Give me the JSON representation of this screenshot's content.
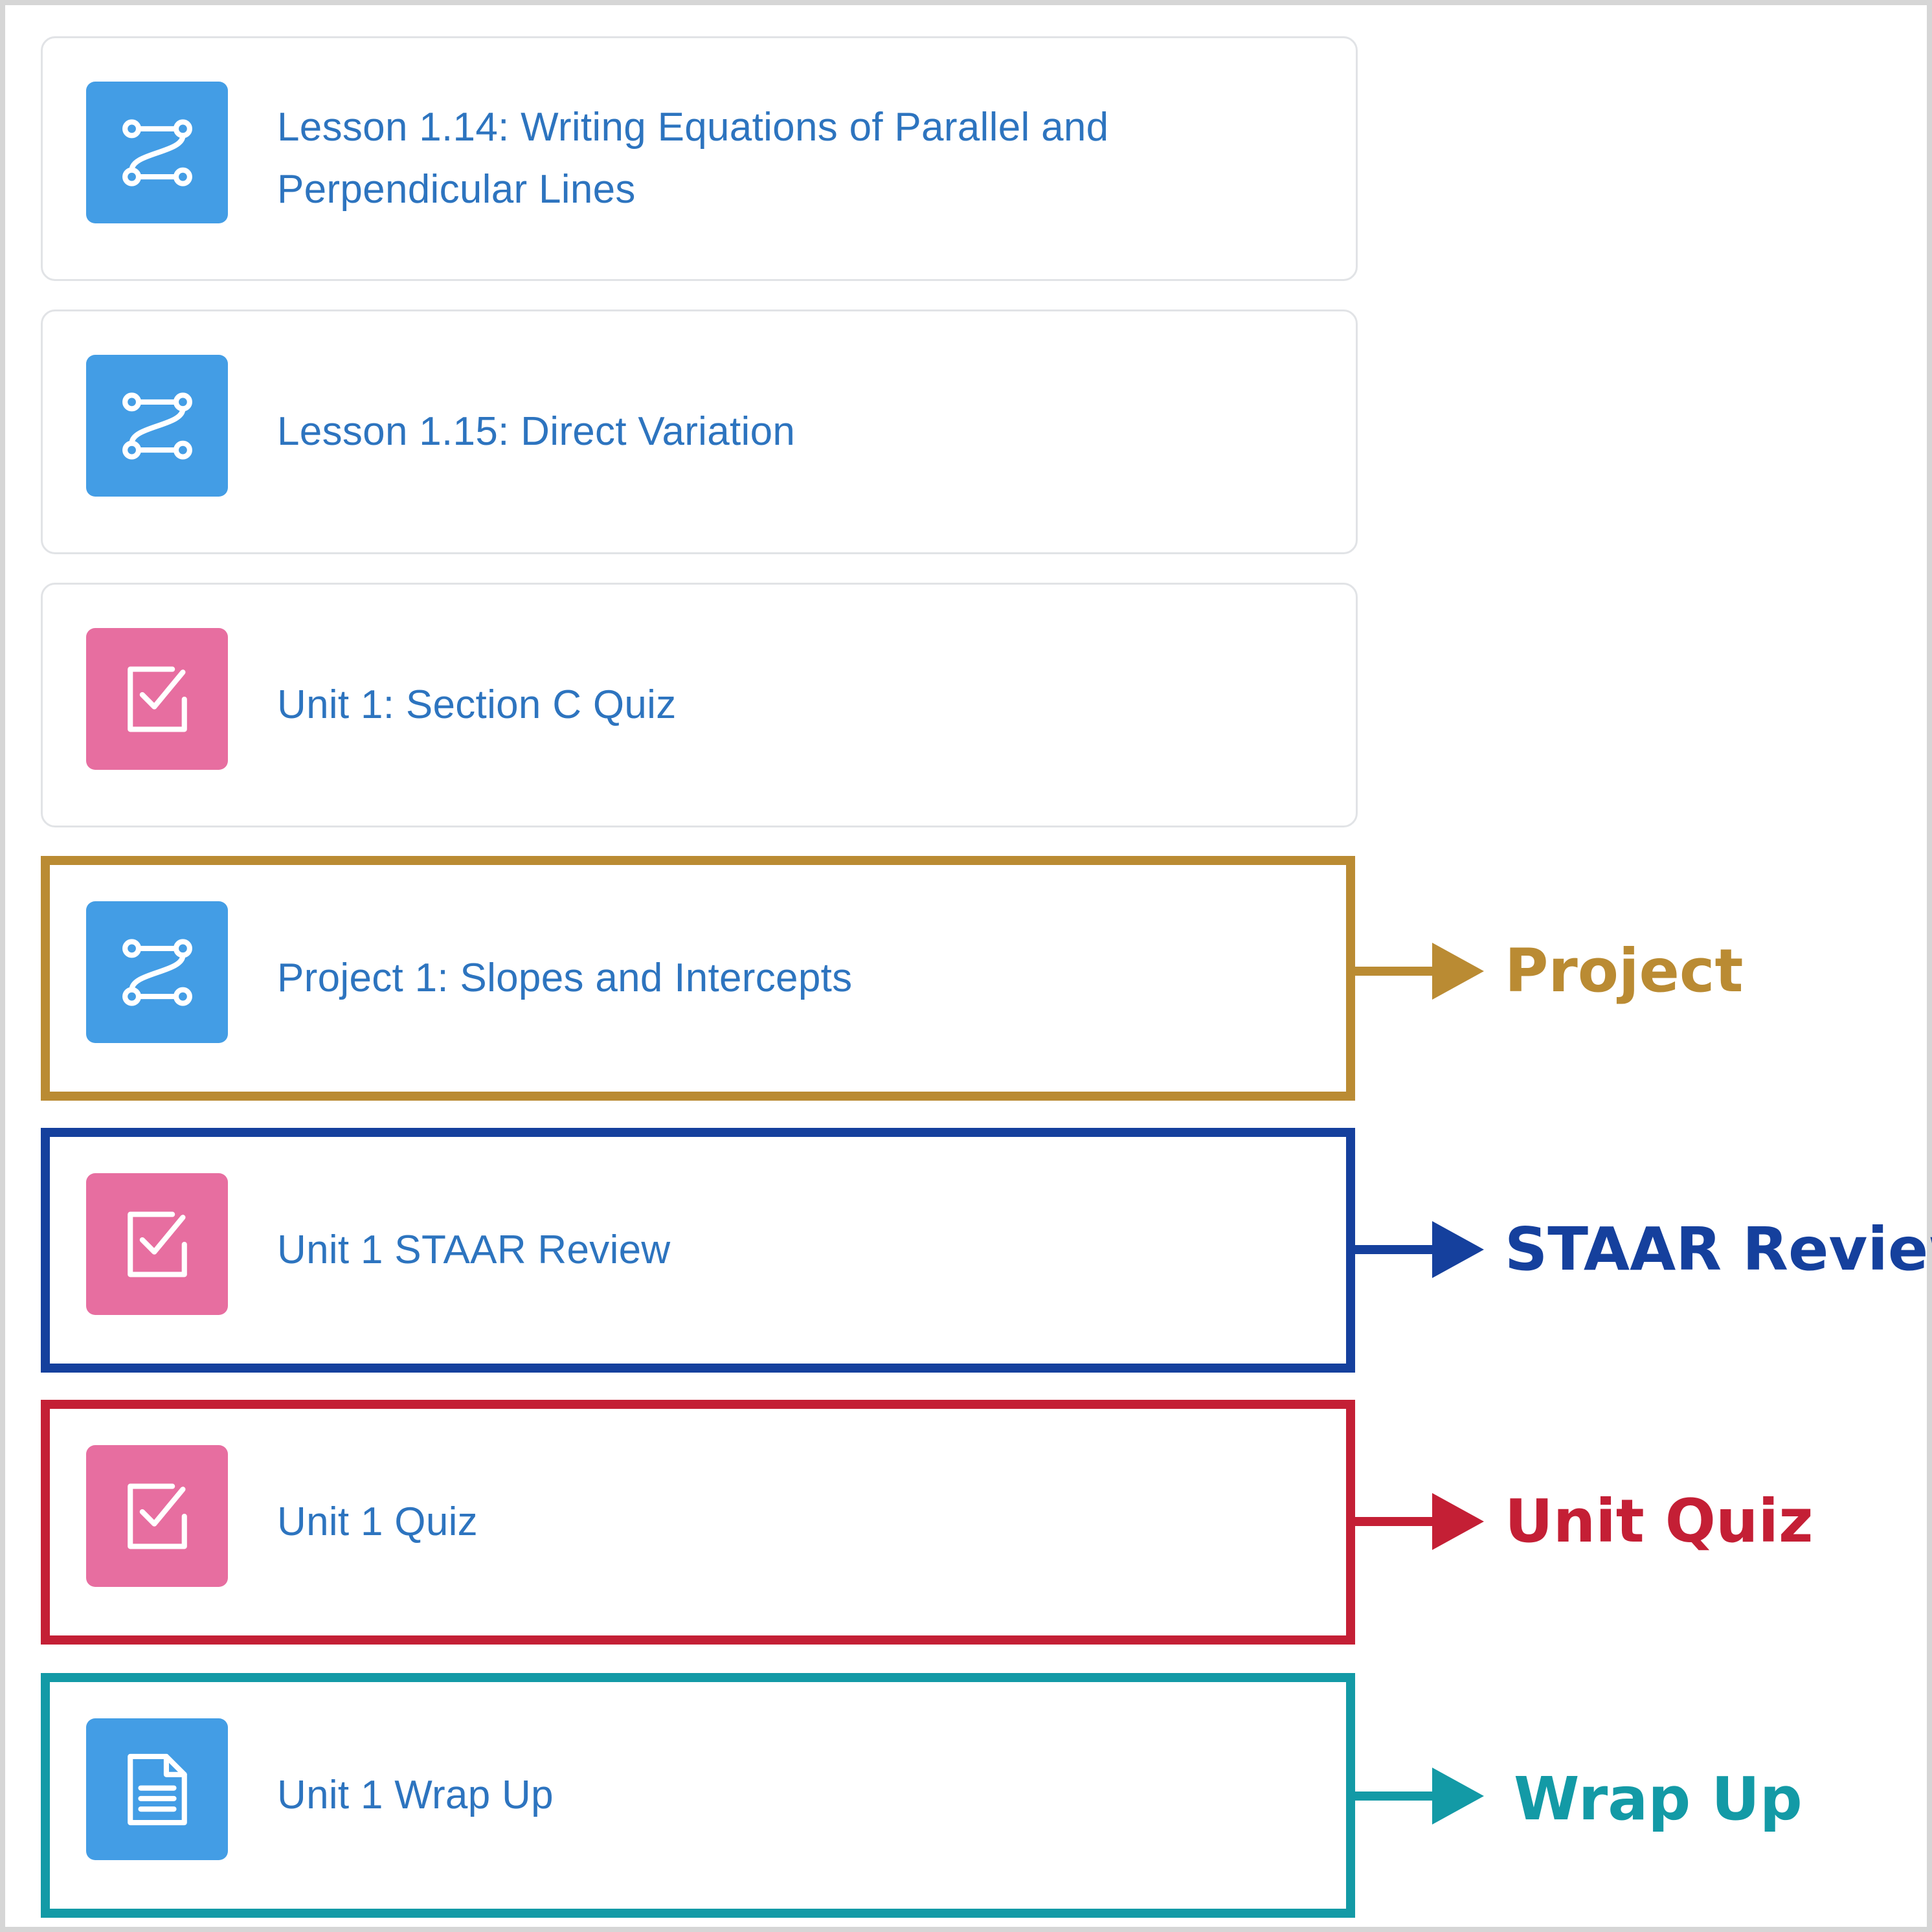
{
  "colors": {
    "link_text": "#2d74bf",
    "tile_blue": "#439de5",
    "tile_pink": "#e76ea0",
    "card_border": "#e1e3e6",
    "project": "#ba8b33",
    "staar_review": "#15409d",
    "unit_quiz": "#c41f35",
    "wrap_up": "#139aa6"
  },
  "items": [
    {
      "label": "Lesson 1.14: Writing Equations of Parallel and Perpendicular Lines",
      "icon": "flow-path-icon",
      "icon_color": "blue"
    },
    {
      "label": "Lesson 1.15: Direct Variation",
      "icon": "flow-path-icon",
      "icon_color": "blue"
    },
    {
      "label": "Unit 1: Section C Quiz",
      "icon": "checkbox-quiz-icon",
      "icon_color": "pink"
    },
    {
      "label": "Project 1: Slopes and Intercepts",
      "icon": "flow-path-icon",
      "icon_color": "blue"
    },
    {
      "label": "Unit 1 STAAR Review",
      "icon": "checkbox-quiz-icon",
      "icon_color": "pink"
    },
    {
      "label": "Unit 1 Quiz",
      "icon": "checkbox-quiz-icon",
      "icon_color": "pink"
    },
    {
      "label": "Unit 1 Wrap Up",
      "icon": "document-icon",
      "icon_color": "blue"
    }
  ],
  "annotations": [
    {
      "label": "Project",
      "color": "#ba8b33",
      "target_item": 3
    },
    {
      "label": "STAAR Review",
      "color": "#15409d",
      "target_item": 4
    },
    {
      "label": "Unit Quiz",
      "color": "#c41f35",
      "target_item": 5
    },
    {
      "label": "Wrap Up",
      "color": "#139aa6",
      "target_item": 6
    }
  ]
}
